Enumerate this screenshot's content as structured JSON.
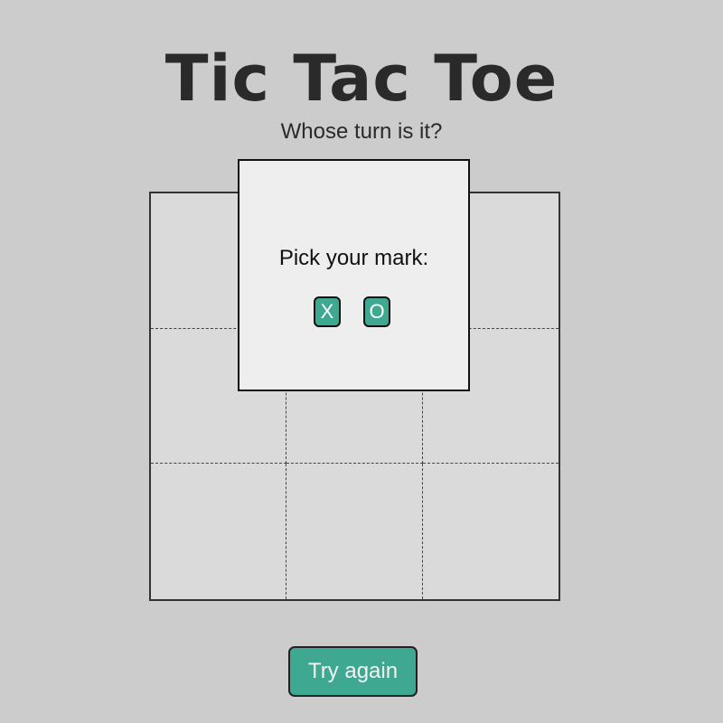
{
  "title": "Tic Tac Toe",
  "status": "Whose turn is it?",
  "board": {
    "cells": [
      "",
      "",
      "",
      "",
      "",
      "",
      "",
      "",
      ""
    ]
  },
  "modal": {
    "label": "Pick your mark:",
    "options": [
      "X",
      "O"
    ]
  },
  "try_again_label": "Try again",
  "colors": {
    "background": "#cccccc",
    "board": "#dadada",
    "modal": "#eeeeee",
    "accent": "#3ea890",
    "text": "#2a2a2a"
  }
}
